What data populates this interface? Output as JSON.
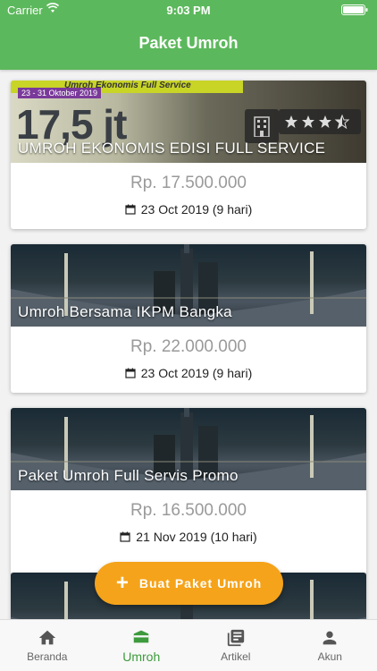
{
  "status": {
    "carrier": "Carrier",
    "time": "9:03 PM"
  },
  "header": {
    "title": "Paket Umroh"
  },
  "packages": [
    {
      "title": "UMROH EKONOMIS EDISI FULL SERVICE",
      "price": "Rp. 17.500.000",
      "date": "23 Oct 2019 (9 hari)",
      "promo": {
        "banner": "Umroh Ekonomis Full Service",
        "dates": "23 - 31 Oktober 2019",
        "big": "17,5 jt",
        "rating_stars": 3.5
      }
    },
    {
      "title": "Umroh Bersama IKPM Bangka",
      "price": "Rp. 22.000.000",
      "date": "23 Oct 2019 (9 hari)"
    },
    {
      "title": "Paket Umroh Full Servis Promo",
      "price": "Rp. 16.500.000",
      "date": "21 Nov 2019 (10 hari)"
    }
  ],
  "fab": {
    "label": "Buat Paket Umroh"
  },
  "nav": [
    {
      "label": "Beranda",
      "icon": "home-icon"
    },
    {
      "label": "Umroh",
      "icon": "kaaba-icon",
      "active": true
    },
    {
      "label": "Artikel",
      "icon": "articles-icon"
    },
    {
      "label": "Akun",
      "icon": "person-icon"
    }
  ],
  "colors": {
    "primary": "#5cb85c",
    "accent": "#f5a31a",
    "active_nav": "#3d9a3d"
  }
}
